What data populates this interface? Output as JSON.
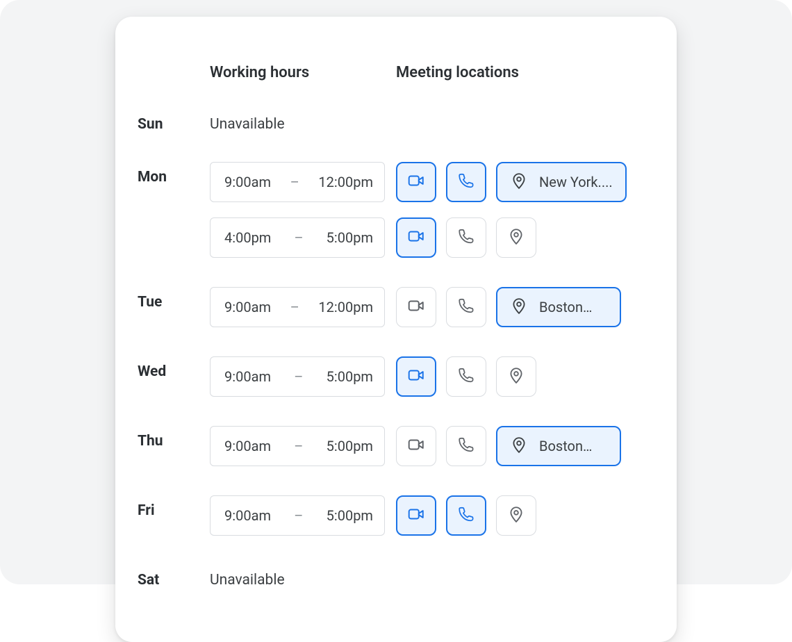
{
  "headers": {
    "working_hours": "Working hours",
    "meeting_locations": "Meeting locations"
  },
  "unavailable_label": "Unavailable",
  "colors": {
    "accent": "#1a73e8",
    "accent_bg": "#eaf3fe",
    "border": "#d9dce0",
    "text": "#2b2f33",
    "muted": "#5f6368"
  },
  "icons": {
    "video": "video-icon",
    "phone": "phone-icon",
    "pin": "location-pin-icon"
  },
  "days": [
    {
      "label": "Sun",
      "unavailable": true,
      "slots": []
    },
    {
      "label": "Mon",
      "unavailable": false,
      "slots": [
        {
          "start": "9:00am",
          "end": "12:00pm",
          "locations": {
            "video": true,
            "phone": true,
            "pin_label": "New York....",
            "pin_active": true
          }
        },
        {
          "start": "4:00pm",
          "end": "5:00pm",
          "locations": {
            "video": true,
            "phone": false,
            "pin_label": "",
            "pin_active": false
          }
        }
      ]
    },
    {
      "label": "Tue",
      "unavailable": false,
      "slots": [
        {
          "start": "9:00am",
          "end": "12:00pm",
          "locations": {
            "video": false,
            "phone": false,
            "pin_label": "Boston…",
            "pin_active": true
          }
        }
      ]
    },
    {
      "label": "Wed",
      "unavailable": false,
      "slots": [
        {
          "start": "9:00am",
          "end": "5:00pm",
          "locations": {
            "video": true,
            "phone": false,
            "pin_label": "",
            "pin_active": false
          }
        }
      ]
    },
    {
      "label": "Thu",
      "unavailable": false,
      "slots": [
        {
          "start": "9:00am",
          "end": "5:00pm",
          "locations": {
            "video": false,
            "phone": false,
            "pin_label": "Boston…",
            "pin_active": true
          }
        }
      ]
    },
    {
      "label": "Fri",
      "unavailable": false,
      "slots": [
        {
          "start": "9:00am",
          "end": "5:00pm",
          "locations": {
            "video": true,
            "phone": true,
            "pin_label": "",
            "pin_active": false
          }
        }
      ]
    },
    {
      "label": "Sat",
      "unavailable": true,
      "slots": []
    }
  ]
}
